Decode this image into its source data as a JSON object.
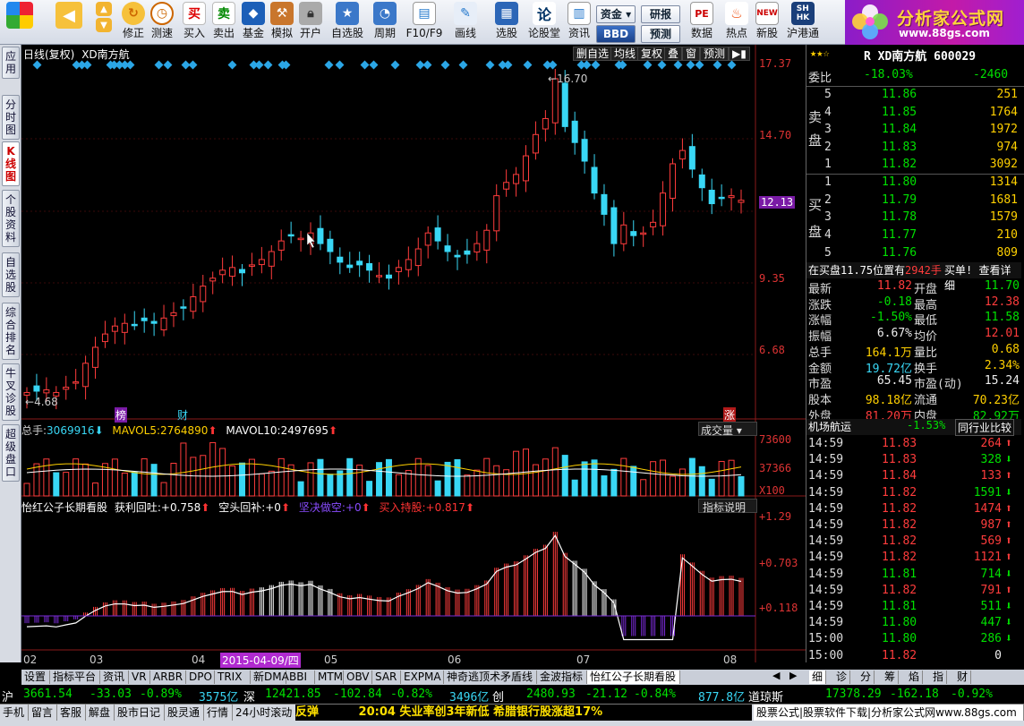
{
  "toolbar": {
    "buttons": [
      "修正",
      "测速",
      "买入",
      "卖出",
      "基金",
      "模拟",
      "开户",
      "自选股",
      "周期",
      "F10/F9",
      "画线",
      "选股",
      "论股堂",
      "资讯",
      "数据",
      "热点",
      "新股",
      "沪港通"
    ],
    "boxes": {
      "capital": "资金",
      "research": "研报",
      "bbd": "BBD",
      "predict": "预测",
      "pe": "PE",
      "hot": "HOT"
    }
  },
  "logo": {
    "main": "分析家公式网",
    "url": "www.88gs.com"
  },
  "left_tabs": [
    "应用",
    "分时图",
    "K线图",
    "个股资料",
    "自选股",
    "综合排名",
    "牛叉诊股",
    "超级盘口"
  ],
  "chart_header": {
    "period": "日线(复权)",
    "name": "XD南方航"
  },
  "chart_buttons": [
    "删自选",
    "均线",
    "复权",
    "叠",
    "窗",
    "预测"
  ],
  "price_axis": [
    "17.37",
    "14.70",
    "12.13",
    "9.35",
    "6.68"
  ],
  "current_price_tag": "12.13",
  "annotations": {
    "high": "16.70",
    "low": "4.68",
    "bang": "榜",
    "cai": "财",
    "zhang": "涨"
  },
  "volume_header": {
    "total_label": "总手:",
    "total": "3069916",
    "ma5_label": "MAVOL5:",
    "ma5": "2764890",
    "ma10_label": "MAVOL10:",
    "ma10": "2497695",
    "selector": "成交量"
  },
  "volume_axis": [
    "73600",
    "37366",
    "X100"
  ],
  "indicator_header": {
    "name": "怡红公子长期看股",
    "l1": "获利回吐:",
    "v1": "+0.758",
    "l2": "空头回补:",
    "v2": "+0",
    "l3": "坚决做空:",
    "v3": "+0",
    "l4": "买入持股:",
    "v4": "+0.817",
    "explain": "指标说明"
  },
  "indicator_axis": [
    "+1.29",
    "+0.703",
    "+0.118"
  ],
  "x_axis": [
    "02",
    "03",
    "04",
    "05",
    "06",
    "07",
    "08"
  ],
  "date_highlight": "2015-04-09/四",
  "chart_data": {
    "type": "candlestick",
    "title": "XD南方航 日线(复权)",
    "ylim": [
      4.68,
      17.37
    ],
    "price_ticks": [
      17.37,
      14.7,
      12.13,
      9.35,
      6.68
    ],
    "high": 16.7,
    "low": 4.68,
    "last": 12.13,
    "x_ticks": [
      "02",
      "03",
      "04",
      "05",
      "06",
      "07",
      "08"
    ],
    "volume": {
      "total": 3069916,
      "mavol5": 2764890,
      "mavol10": 2497695,
      "ticks": [
        73600,
        37366
      ],
      "unit": "X100"
    },
    "indicator": {
      "name": "怡红公子长期看股",
      "ticks": [
        1.29,
        0.703,
        0.118
      ]
    },
    "close_path": [
      4.9,
      4.95,
      5.0,
      4.9,
      5.1,
      5.3,
      6.0,
      6.6,
      7.1,
      7.4,
      7.5,
      7.45,
      7.6,
      7.5,
      7.7,
      7.9,
      8.1,
      8.5,
      8.9,
      9.2,
      9.5,
      9.6,
      9.4,
      9.7,
      9.9,
      10.2,
      10.6,
      10.8,
      10.7,
      10.9,
      10.5,
      10.2,
      9.8,
      9.6,
      9.7,
      9.5,
      9.3,
      9.2,
      9.6,
      9.9,
      10.3,
      10.9,
      10.6,
      10.2,
      10.0,
      10.1,
      10.5,
      11.0,
      12.3,
      12.8,
      13.1,
      13.8,
      14.6,
      15.2,
      16.7,
      14.9,
      14.3,
      13.6,
      12.4,
      11.6,
      10.5,
      11.2,
      10.8,
      10.9,
      11.3,
      12.4,
      13.5,
      14.0,
      13.3,
      12.6,
      12.0,
      12.2,
      12.3,
      12.13
    ]
  },
  "quote": {
    "code_line": "R XD南方航 600029",
    "weibi_label": "委比",
    "weibi": "-18.03%",
    "weicha": "-2460",
    "sell_label1": "卖",
    "sell_label2": "盘",
    "sells": [
      {
        "lvl": "5",
        "price": "11.86",
        "vol": "251"
      },
      {
        "lvl": "4",
        "price": "11.85",
        "vol": "1764"
      },
      {
        "lvl": "3",
        "price": "11.84",
        "vol": "1972"
      },
      {
        "lvl": "2",
        "price": "11.83",
        "vol": "974"
      },
      {
        "lvl": "1",
        "price": "11.82",
        "vol": "3092"
      }
    ],
    "buy_label1": "买",
    "buy_label2": "盘",
    "buys": [
      {
        "lvl": "1",
        "price": "11.80",
        "vol": "1314"
      },
      {
        "lvl": "2",
        "price": "11.79",
        "vol": "1681"
      },
      {
        "lvl": "3",
        "price": "11.78",
        "vol": "1579"
      },
      {
        "lvl": "4",
        "price": "11.77",
        "vol": "210"
      },
      {
        "lvl": "5",
        "price": "11.76",
        "vol": "809"
      }
    ],
    "notice": "在买盘11.75位置有",
    "notice_vol": "2942手",
    "notice_tail": "买单! 查看详细",
    "stats": [
      {
        "l": "最新",
        "v": "11.82",
        "c": "red",
        "l2": "开盘",
        "v2": "11.70",
        "c2": "green"
      },
      {
        "l": "涨跌",
        "v": "-0.18",
        "c": "green",
        "l2": "最高",
        "v2": "12.38",
        "c2": "red"
      },
      {
        "l": "涨幅",
        "v": "-1.50%",
        "c": "green",
        "l2": "最低",
        "v2": "11.58",
        "c2": "green"
      },
      {
        "l": "振幅",
        "v": "6.67%",
        "c": "white",
        "l2": "均价",
        "v2": "12.01",
        "c2": "red"
      },
      {
        "l": "总手",
        "v": "164.1万",
        "c": "yellow",
        "l2": "量比",
        "v2": "0.68",
        "c2": "yellow"
      },
      {
        "l": "金额",
        "v": "19.72亿",
        "c": "cyan",
        "l2": "换手",
        "v2": "2.34%",
        "c2": "yellow"
      },
      {
        "l": "市盈",
        "v": "65.45",
        "c": "white",
        "l2": "市盈(动)",
        "v2": "15.24",
        "c2": "white"
      },
      {
        "l": "股本",
        "v": "98.18亿",
        "c": "yellow",
        "l2": "流通",
        "v2": "70.23亿",
        "c2": "yellow"
      },
      {
        "l": "外盘",
        "v": "81.20万",
        "c": "red",
        "l2": "内盘",
        "v2": "82.92万",
        "c2": "green"
      }
    ],
    "sector": "机场航运",
    "sector_chg": "-1.53%",
    "compare": "同行业比较",
    "ticks": [
      {
        "t": "14:59",
        "p": "11.83",
        "v": "264",
        "d": "up"
      },
      {
        "t": "14:59",
        "p": "11.83",
        "v": "328",
        "d": "down"
      },
      {
        "t": "14:59",
        "p": "11.84",
        "v": "133",
        "d": "up"
      },
      {
        "t": "14:59",
        "p": "11.82",
        "v": "1591",
        "d": "down"
      },
      {
        "t": "14:59",
        "p": "11.82",
        "v": "1474",
        "d": "up"
      },
      {
        "t": "14:59",
        "p": "11.82",
        "v": "987",
        "d": "up"
      },
      {
        "t": "14:59",
        "p": "11.82",
        "v": "569",
        "d": "up"
      },
      {
        "t": "14:59",
        "p": "11.82",
        "v": "1121",
        "d": "up"
      },
      {
        "t": "14:59",
        "p": "11.81",
        "v": "714",
        "d": "down"
      },
      {
        "t": "14:59",
        "p": "11.82",
        "v": "791",
        "d": "up"
      },
      {
        "t": "14:59",
        "p": "11.81",
        "v": "511",
        "d": "down"
      },
      {
        "t": "14:59",
        "p": "11.80",
        "v": "447",
        "d": "down"
      },
      {
        "t": "15:00",
        "p": "11.80",
        "v": "286",
        "d": "down"
      },
      {
        "t": "15:00",
        "p": "11.82",
        "v": "0",
        "d": "none"
      }
    ],
    "bottom_tabs": [
      "细",
      "诊",
      "分",
      "筹",
      "焰",
      "指",
      "财"
    ]
  },
  "bottom_tabs": [
    "设置",
    "指标平台",
    "资讯",
    "VR",
    "ARBR",
    "DPO",
    "TRIX",
    "新DMA",
    "BBI",
    "MTM",
    "OBV",
    "SAR",
    "EXPMA",
    "神奇逃顶术矛盾线",
    "金波指标",
    "怡红公子长期看股"
  ],
  "ticker": {
    "sh": "沪",
    "sh_val": "3661.54",
    "sh_chg": "-33.03",
    "sh_pct": "-0.89%",
    "sh_amt": "3575亿",
    "sz": "深",
    "sz_val": "12421.85",
    "sz_chg": "-102.84",
    "sz_pct": "-0.82%",
    "sz_amt": "3496亿",
    "cy": "创",
    "cy_val": "2480.93",
    "cy_chg": "-21.12",
    "cy_pct": "-0.84%",
    "cy_amt": "877.8亿",
    "dj": "道琼斯",
    "dj_val": "17378.29",
    "dj_chg": "-162.18",
    "dj_pct": "-0.92%"
  },
  "statusbar": {
    "items": [
      "手机",
      "留言",
      "客服",
      "解盘",
      "股市日记",
      "股灵通",
      "行情",
      "24小时滚动"
    ],
    "fanta": "反弹",
    "news": "20:04 失业率创3年新低 希腊银行股涨超17%",
    "site": "股票公式|股票软件下载|分析家公式网www.88gs.com"
  }
}
